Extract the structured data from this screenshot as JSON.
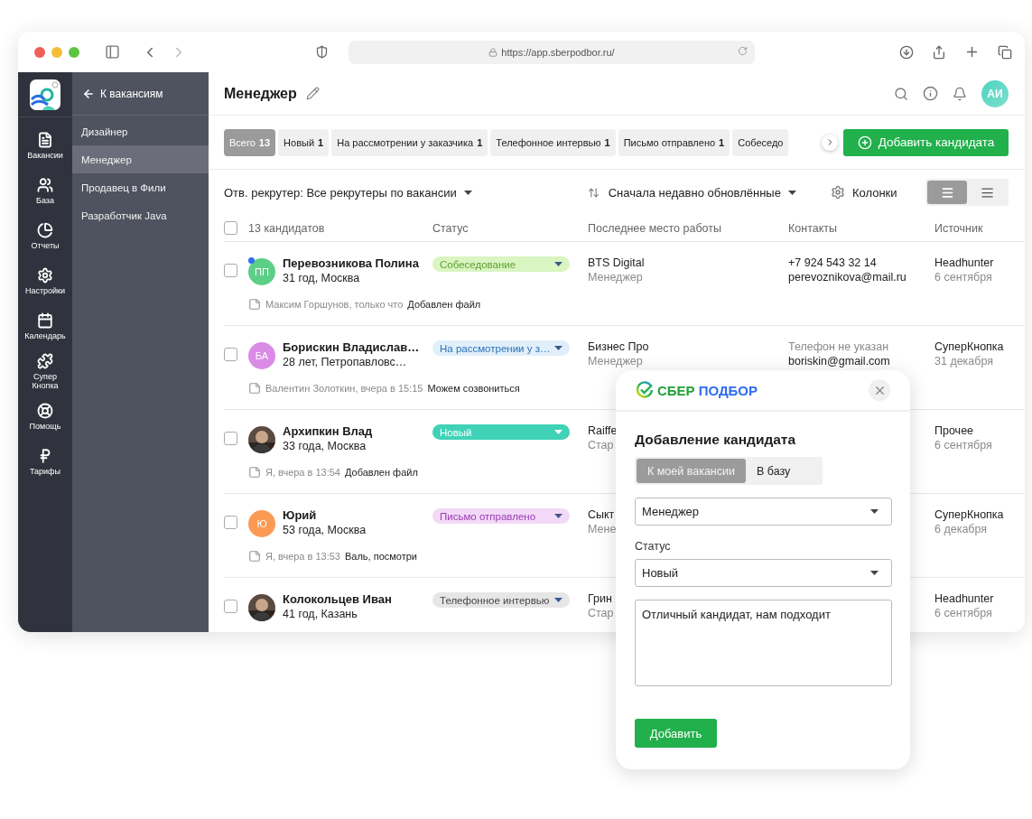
{
  "browser": {
    "url": "https://app.sberpodbor.ru/"
  },
  "rail": [
    {
      "kind": "file",
      "label": "Вакансии"
    },
    {
      "kind": "users",
      "label": "База"
    },
    {
      "kind": "chart",
      "label": "Отчеты"
    },
    {
      "kind": "settings",
      "label": "Настройки"
    },
    {
      "kind": "calendar",
      "label": "Календарь"
    },
    {
      "kind": "puzzle",
      "label": "Супер Кнопка"
    },
    {
      "kind": "help",
      "label": "Помощь"
    },
    {
      "kind": "ruble",
      "label": "Тарифы"
    }
  ],
  "submenu": {
    "back": "К вакансиям",
    "items": [
      {
        "label": "Дизайнер",
        "selected": false
      },
      {
        "label": "Менеджер",
        "selected": true
      },
      {
        "label": "Продавец в Фили",
        "selected": false
      },
      {
        "label": "Разработчик Java",
        "selected": false
      }
    ]
  },
  "header": {
    "title": "Менеджер",
    "user_initials": "АИ"
  },
  "chips": [
    {
      "label": "Всего",
      "count": "13",
      "selected": true
    },
    {
      "label": "Новый",
      "count": "1",
      "selected": false
    },
    {
      "label": "На рассмотрении у заказчика",
      "count": "1",
      "selected": false
    },
    {
      "label": "Телефонное интервью",
      "count": "1",
      "selected": false
    },
    {
      "label": "Письмо отправлено",
      "count": "1",
      "selected": false
    },
    {
      "label": "Собеседо",
      "selected": false
    }
  ],
  "add_button": "Добавить кандидата",
  "toolbar": {
    "recruiter": "Отв. рекрутер: Все рекрутеры по вакансии",
    "sort": "Сначала недавно обновлённые",
    "columns": "Колонки",
    "view_modes": [
      {
        "kind": "comfortable",
        "selected": true
      },
      {
        "kind": "compact",
        "selected": false
      }
    ]
  },
  "table": {
    "all_checked": false,
    "count": "13 кандидатов",
    "columns": [
      "Статус",
      "Последнее место работы",
      "Контакты",
      "Источник"
    ],
    "rows": [
      {
        "checked": false,
        "unread": true,
        "avatar": {
          "kind": "initials",
          "text": "ПП",
          "color": "#5ccf86"
        },
        "name": "Перевозникова Полина",
        "details": "31 год, Москва",
        "status": {
          "label": "Собеседование",
          "kind": "green",
          "color": "#d9f5c1"
        },
        "work": {
          "company": "BTS Digital",
          "position": "Менеджер"
        },
        "contacts": [
          {
            "text": "+7 924 543 32 14",
            "muted": false
          },
          {
            "text": "perevoznikova@mail.ru",
            "muted": false
          }
        ],
        "source": {
          "name": "Headhunter",
          "date": "6 сентября"
        },
        "note": {
          "author": "Максим Горшунов, только что",
          "text": "Добавлен файл"
        }
      },
      {
        "checked": false,
        "unread": false,
        "avatar": {
          "kind": "initials",
          "text": "БА",
          "color": "#d98be6"
        },
        "name": "Борискин Владислав…",
        "details": "28 лет, Петропавловс…",
        "status": {
          "label": "На рассмотрении у з…",
          "kind": "blue",
          "color": "#e1effa"
        },
        "work": {
          "company": "Бизнес Про",
          "position": "Менеджер"
        },
        "contacts": [
          {
            "text": "Телефон не указан",
            "muted": true
          },
          {
            "text": "boriskin@gmail.com",
            "muted": false
          }
        ],
        "source": {
          "name": "СуперКнопка",
          "date": "31 декабря"
        },
        "note": {
          "author": "Валентин Золоткин, вчера в 15:15",
          "text": "Можем созвониться"
        }
      },
      {
        "checked": false,
        "unread": false,
        "name": "Архипкин Влад",
        "details": "33 года, Москва",
        "status": {
          "label": "Новый",
          "kind": "teal",
          "color": "#3fd2b6"
        },
        "work": {
          "company": "Raiffe",
          "position": "Стар"
        },
        "source": {
          "name": "Прочее",
          "date": "6 сентября"
        },
        "note": {
          "author": "Я, вчера в 13:54",
          "text": "Добавлен файл"
        }
      },
      {
        "checked": false,
        "unread": false,
        "avatar": {
          "kind": "initials",
          "text": "Ю",
          "color": "#fb9a55"
        },
        "name": "Юрий",
        "details": "53 года, Москва",
        "status": {
          "label": "Письмо отправлено",
          "kind": "pink",
          "color": "#f3d9f7"
        },
        "work": {
          "company": "Сыкт",
          "position": "Мене"
        },
        "source": {
          "name": "СуперКнопка",
          "date": "6 декабря"
        },
        "note": {
          "author": "Я, вчера в 13:53",
          "text": "Валь, посмотри"
        }
      },
      {
        "checked": false,
        "unread": false,
        "name": "Колокольцев Иван",
        "details": "41 год, Казань",
        "status": {
          "label": "Телефонное интервью",
          "kind": "grey",
          "color": "#e6e6e6"
        },
        "work": {
          "company": "Грин",
          "position": "Стар"
        },
        "source": {
          "name": "Headhunter",
          "date": "6 сентября"
        }
      }
    ]
  },
  "dialog": {
    "logo": {
      "first": "СБЕР",
      "second": "ПОДБОР"
    },
    "title": "Добавление кандидата",
    "tabs": [
      {
        "label": "К моей вакансии",
        "selected": true
      },
      {
        "label": "В базу",
        "selected": false
      }
    ],
    "vacancy": "Менеджер",
    "status_label": "Статус",
    "status": "Новый",
    "comment": "Отличный кандидат, нам подходит",
    "submit": "Добавить"
  }
}
